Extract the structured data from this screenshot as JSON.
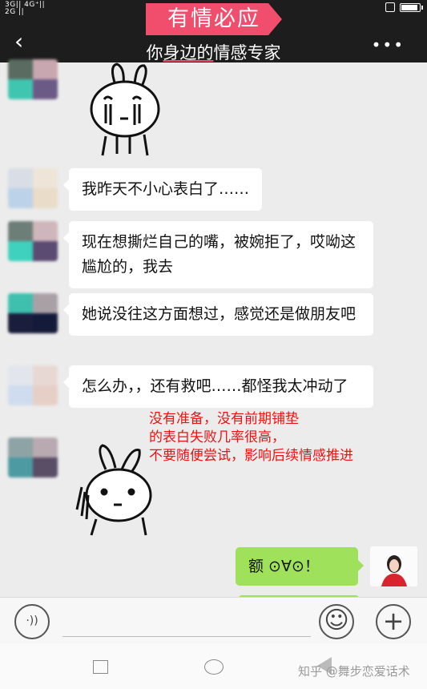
{
  "status": {
    "left": "3G|| 4G⁺||\n2G ||"
  },
  "header": {
    "brand": "有情必应",
    "subtitle_pre": "你",
    "subtitle_underline": "身边的",
    "subtitle_post": "情感专家",
    "back_icon": "‹",
    "more_icon": "•••"
  },
  "messages": [
    {
      "text": "我昨天不小心表白了……"
    },
    {
      "text": "现在想撕烂自己的嘴，被婉拒了，哎呦这尴尬的，我去"
    },
    {
      "text": "她说没往这方面想过，感觉还是做朋友吧"
    },
    {
      "text": "怎么办，，还有救吧……都怪我太冲动了"
    }
  ],
  "annotation": {
    "line1": "没有准备，没有前期铺垫",
    "line2": "的表白失败几率很高，",
    "line3": "不要随便尝试，影响后续情感推进"
  },
  "my_message": {
    "text": "额 ⊙∀⊙！"
  },
  "input": {
    "voice_icon": "·))",
    "emoji_icon": "☺",
    "plus_icon": "+"
  },
  "watermark": "知乎 @舞步恋爱话术"
}
